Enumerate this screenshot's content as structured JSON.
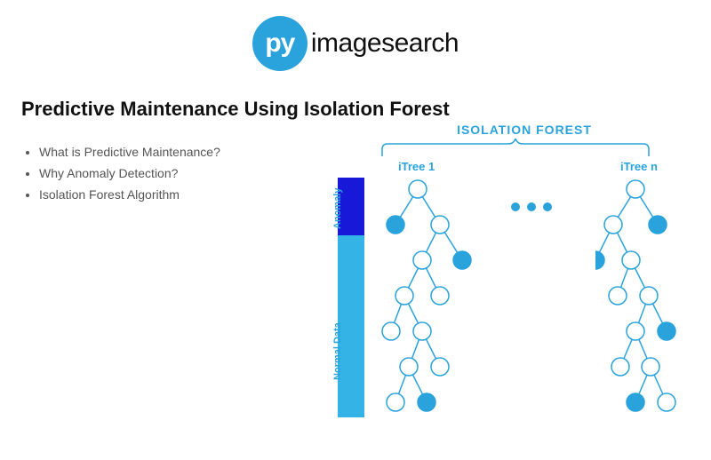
{
  "logo": {
    "py": "py",
    "rest": "imagesearch"
  },
  "title": "Predictive Maintenance Using Isolation Forest",
  "bullets": [
    "What is Predictive Maintenance?",
    "Why Anomaly Detection?",
    "Isolation Forest Algorithm"
  ],
  "diagram": {
    "forest_label": "ISOLATION FOREST",
    "tree1_label": "iTree 1",
    "tree2_label": "iTree n",
    "anomaly_label": "Anomaly",
    "normal_label": "Normal Data"
  }
}
